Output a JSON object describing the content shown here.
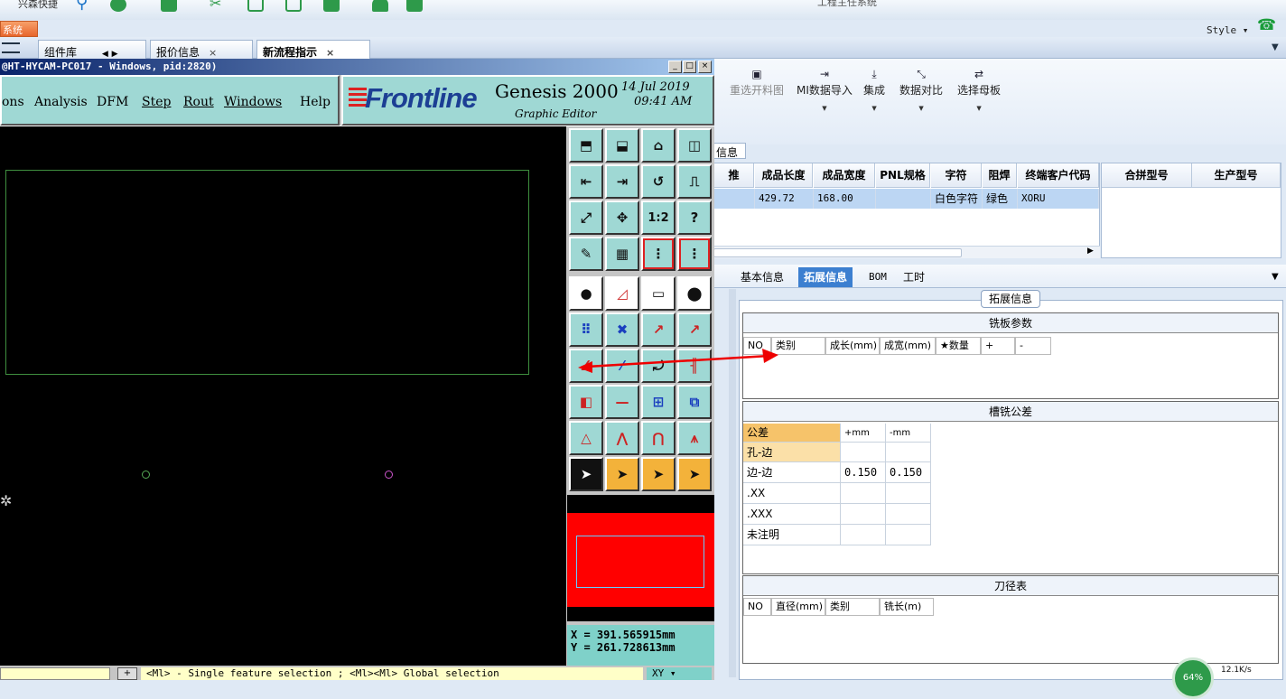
{
  "app": {
    "quick_access": "兴森快捷",
    "title_partial": "工程主任系统",
    "style_label": "Style",
    "system_button": "系统"
  },
  "tabs": [
    {
      "label": "组件库"
    },
    {
      "label": "报价信息",
      "close": "×"
    },
    {
      "label": "新流程指示",
      "close": "×"
    }
  ],
  "genesis": {
    "title": "@HT-HYCAM-PC017 - Windows, pid:2820)",
    "menu": [
      "ons",
      "Analysis",
      "DFM",
      "Step",
      "Rout",
      "Windows",
      "Help"
    ],
    "brand": "Frontline",
    "product": "Genesis 2000",
    "subtitle": "Graphic Editor",
    "date": "14 Jul 2019",
    "time": "09:41 AM",
    "coord_x": "X = 391.565915mm",
    "coord_y": "Y = 261.728613mm",
    "status": "<Ml> - Single feature selection ; <Ml><Ml> Global selection",
    "status_right": "XY",
    "toolbar_row4": "1:2"
  },
  "right_toolbar": [
    {
      "label": "重选开料图",
      "icon": "image-icon",
      "disabled": true
    },
    {
      "label": "MI数据导入",
      "icon": "import-icon"
    },
    {
      "label": "集成",
      "icon": "download-icon"
    },
    {
      "label": "数据对比",
      "icon": "compare-icon"
    },
    {
      "label": "选择母板",
      "icon": "shuffle-icon"
    }
  ],
  "info_tab": "信息",
  "grid1": {
    "headers": [
      "推",
      "成品长度",
      "成品宽度",
      "PNL规格",
      "字符",
      "阻焊",
      "终端客户代码"
    ],
    "row": [
      "",
      "429.72",
      "168.00",
      "",
      "白色字符",
      "绿色",
      "XORU"
    ]
  },
  "grid2": {
    "headers": [
      "合拼型号",
      "生产型号"
    ]
  },
  "bottom_tabs": [
    "基本信息",
    "拓展信息",
    "BOM",
    "工时"
  ],
  "ext": {
    "legend": "拓展信息",
    "mill_title": "铣板参数",
    "mill_cols": [
      "NO",
      "类别",
      "成长(mm)",
      "成宽(mm)",
      "★数量",
      "+",
      "-"
    ],
    "tol_title": "槽铣公差",
    "tol_cols": [
      "公差",
      "+mm",
      "-mm"
    ],
    "tol_rows": [
      {
        "name": "孔-边",
        "plus": "",
        "minus": ""
      },
      {
        "name": "边-边",
        "plus": "0.150",
        "minus": "0.150"
      },
      {
        "name": ".XX",
        "plus": "",
        "minus": ""
      },
      {
        "name": ".XXX",
        "plus": "",
        "minus": ""
      },
      {
        "name": "未注明",
        "plus": "",
        "minus": ""
      }
    ],
    "knife_title": "刀径表",
    "knife_cols": [
      "NO",
      "直径(mm)",
      "类别",
      "铣长(m)"
    ]
  },
  "network": {
    "percent": "64%",
    "speed": "12.1K/s"
  }
}
